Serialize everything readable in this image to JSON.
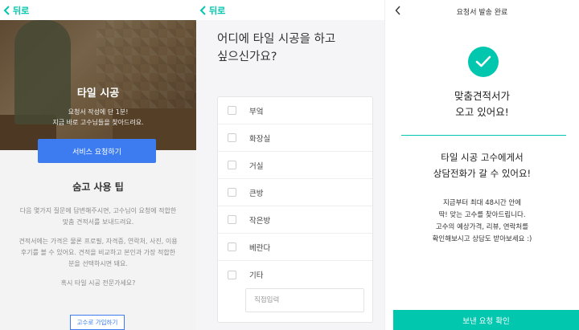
{
  "panel1": {
    "back_label": "뒤로",
    "hero_title": "타일 시공",
    "hero_subtitle_line1": "요청서 작성에 단 1분!",
    "hero_subtitle_line2": "지금 바로 고수님들을 찾아드려요.",
    "cta_label": "서비스 요청하기",
    "tips_title": "숨고 사용 팁",
    "tips_p1_line1": "다음 몇가지 질문에 답변해주시면, 고수님이 요청에 적합한",
    "tips_p1_line2": "맞춤 견적서를 보내드려요.",
    "tips_p2_line1": "견적서에는 가격은 물론 프로필, 자격증, 연락처, 사진, 이용",
    "tips_p2_line2": "후기를 볼 수 있어요. 견적을 비교하고 본인과 가장 적합한",
    "tips_p2_line3": "분을 선택하시면 돼요.",
    "tips_p3": "혹시 타일 시공 전문가세요?",
    "join_label": "고수로 가입하기"
  },
  "panel2": {
    "back_label": "뒤로",
    "question_line1": "어디에 타일 시공을 하고",
    "question_line2": "싶으신가요?",
    "options": [
      "부엌",
      "화장실",
      "거실",
      "큰방",
      "작은방",
      "베란다"
    ],
    "other_label": "기타",
    "other_placeholder": "직접입력"
  },
  "panel3": {
    "header_title": "요청서 발송 완료",
    "done_line1": "맞춤견적서가",
    "done_line2": "오고 있어요!",
    "msg_line1": "타일 시공 고수에게서",
    "msg_line2": "상담전화가 갈 수 있어요!",
    "body_line1": "지금부터 최대 48시간 안에",
    "body_line2": "딱! 맞는 고수를 찾아드립니다.",
    "body_line3": "고수의 예상가격, 리뷰, 연락처를",
    "body_line4": "확인해보시고 상담도 받아보세요 :)",
    "confirm_label": "보낸 요청 확인"
  },
  "colors": {
    "accent": "#00c7ae",
    "primary_button": "#3c7cf0"
  },
  "icons": {
    "back": "chevron-left-icon",
    "success": "check-icon"
  }
}
